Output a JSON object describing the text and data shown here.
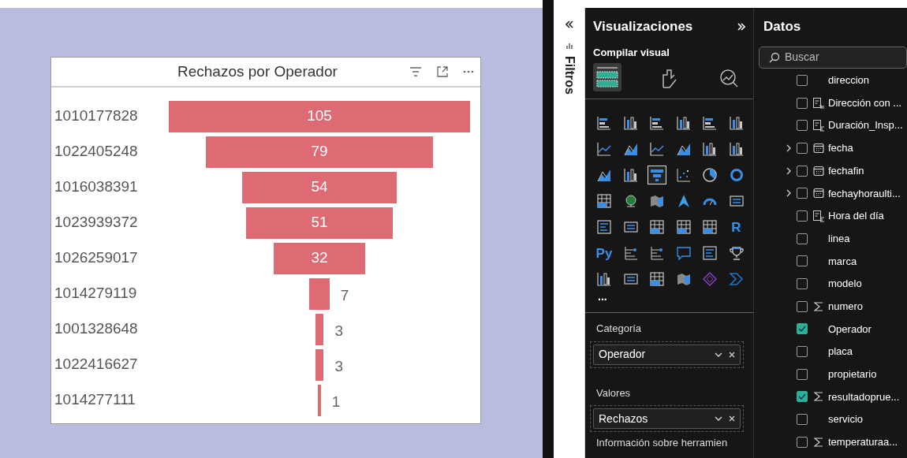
{
  "filters_pane": {
    "title": "Filtros"
  },
  "visual": {
    "title": "Rechazos por Operador",
    "kind": "funnel",
    "stages": [
      {
        "category": "1010177828",
        "value": "105"
      },
      {
        "category": "1022405248",
        "value": "79"
      },
      {
        "category": "1016038391",
        "value": "54"
      },
      {
        "category": "1023939372",
        "value": "51"
      },
      {
        "category": "1026259017",
        "value": "32"
      },
      {
        "category": "1014279119",
        "value": "7"
      },
      {
        "category": "1001328648",
        "value": "3"
      },
      {
        "category": "1022416627",
        "value": "3"
      },
      {
        "category": "1014277111",
        "value": "1"
      }
    ]
  },
  "visualizations": {
    "title": "Visualizaciones",
    "subtitle": "Compilar visual",
    "tabs": [
      {
        "selected": true
      },
      {
        "selected": false
      },
      {
        "selected": false
      }
    ],
    "gallery": [
      {
        "kind": "hbar",
        "selected": false
      },
      {
        "kind": "col",
        "selected": false
      },
      {
        "kind": "hbar",
        "selected": false
      },
      {
        "kind": "col",
        "selected": false
      },
      {
        "kind": "hbar",
        "selected": false
      },
      {
        "kind": "col",
        "selected": false
      },
      {
        "kind": "line",
        "selected": false
      },
      {
        "kind": "area",
        "selected": false
      },
      {
        "kind": "line",
        "selected": false
      },
      {
        "kind": "area",
        "selected": false
      },
      {
        "kind": "col",
        "selected": false
      },
      {
        "kind": "col",
        "selected": false
      },
      {
        "kind": "area",
        "selected": false
      },
      {
        "kind": "col",
        "selected": false
      },
      {
        "kind": "funnel",
        "selected": true
      },
      {
        "kind": "scatter",
        "selected": false
      },
      {
        "kind": "pie",
        "selected": false
      },
      {
        "kind": "donut",
        "selected": false
      },
      {
        "kind": "table",
        "selected": false
      },
      {
        "kind": "globe",
        "selected": false
      },
      {
        "kind": "map",
        "selected": false
      },
      {
        "kind": "arrow",
        "selected": false
      },
      {
        "kind": "gauge",
        "selected": false
      },
      {
        "kind": "card",
        "selected": false
      },
      {
        "kind": "text",
        "selected": false
      },
      {
        "kind": "card",
        "selected": false
      },
      {
        "kind": "table",
        "selected": false
      },
      {
        "kind": "table",
        "selected": false
      },
      {
        "kind": "table",
        "selected": false
      },
      {
        "kind": "letter",
        "label": "R",
        "selected": false
      },
      {
        "kind": "letter",
        "label": "Py",
        "selected": false
      },
      {
        "kind": "tree",
        "selected": false
      },
      {
        "kind": "tree",
        "selected": false
      },
      {
        "kind": "speech",
        "selected": false
      },
      {
        "kind": "text",
        "selected": false
      },
      {
        "kind": "trophy",
        "selected": false
      },
      {
        "kind": "col",
        "selected": false
      },
      {
        "kind": "card",
        "selected": false
      },
      {
        "kind": "table",
        "selected": false
      },
      {
        "kind": "map",
        "selected": false
      },
      {
        "kind": "diamond",
        "selected": false
      },
      {
        "kind": "chevron",
        "selected": false
      }
    ],
    "more": "...",
    "wells": [
      {
        "label": "Categoría",
        "field": "Operador"
      },
      {
        "label": "Valores",
        "field": "Rechazos"
      }
    ],
    "next_section": "Información sobre herramien"
  },
  "data_pane": {
    "title": "Datos",
    "search": {
      "placeholder": "Buscar"
    },
    "fields": [
      {
        "name": "direccion",
        "kind": "column",
        "expandable": false,
        "checked": false
      },
      {
        "name": "Dirección con ...",
        "kind": "calc",
        "expandable": false,
        "checked": false
      },
      {
        "name": "Duración_Insp...",
        "kind": "measure",
        "expandable": false,
        "checked": false
      },
      {
        "name": "fecha",
        "kind": "calendar",
        "expandable": true,
        "checked": false
      },
      {
        "name": "fechafin",
        "kind": "calendar",
        "expandable": true,
        "checked": false
      },
      {
        "name": "fechayhoraulti...",
        "kind": "calendar",
        "expandable": true,
        "checked": false
      },
      {
        "name": "Hora del día",
        "kind": "measure",
        "expandable": false,
        "checked": false
      },
      {
        "name": "linea",
        "kind": "column",
        "expandable": false,
        "checked": false
      },
      {
        "name": "marca",
        "kind": "column",
        "expandable": false,
        "checked": false
      },
      {
        "name": "modelo",
        "kind": "column",
        "expandable": false,
        "checked": false
      },
      {
        "name": "numero",
        "kind": "sigma",
        "expandable": false,
        "checked": false
      },
      {
        "name": "Operador",
        "kind": "column",
        "expandable": false,
        "checked": true
      },
      {
        "name": "placa",
        "kind": "column",
        "expandable": false,
        "checked": false
      },
      {
        "name": "propietario",
        "kind": "column",
        "expandable": false,
        "checked": false
      },
      {
        "name": "resultadoprue...",
        "kind": "sigma",
        "expandable": false,
        "checked": true
      },
      {
        "name": "servicio",
        "kind": "column",
        "expandable": false,
        "checked": false
      },
      {
        "name": "temperaturaa...",
        "kind": "sigma",
        "expandable": false,
        "checked": false
      }
    ]
  }
}
